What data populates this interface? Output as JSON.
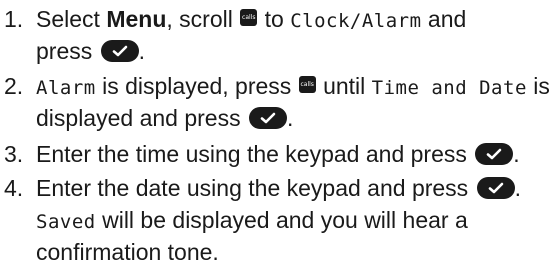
{
  "steps": [
    {
      "number": "1.",
      "lines": [
        {
          "a": "Select ",
          "b": "Menu",
          "c": ", scroll ",
          "d": " to ",
          "e": "Clock/Alarm",
          "f": " and"
        },
        {
          "a": "press "
        }
      ]
    },
    {
      "number": "2.",
      "lines": [
        {
          "a": "Alarm",
          "b": " is displayed, press ",
          "c": " until ",
          "d": "Time and Date",
          "e": " is"
        },
        {
          "a": "displayed and press "
        }
      ]
    },
    {
      "number": "3.",
      "lines": [
        {
          "a": "Enter the time using the keypad and press "
        }
      ]
    },
    {
      "number": "4.",
      "lines": [
        {
          "a": "Enter the date using the keypad and press "
        },
        {
          "a": "Saved",
          "b": " will be displayed and you will hear a"
        },
        {
          "a": "confirmation tone."
        }
      ]
    }
  ],
  "icons": {
    "calls_button_text": "calls",
    "ok_button": "checkmark-icon"
  },
  "period": "."
}
